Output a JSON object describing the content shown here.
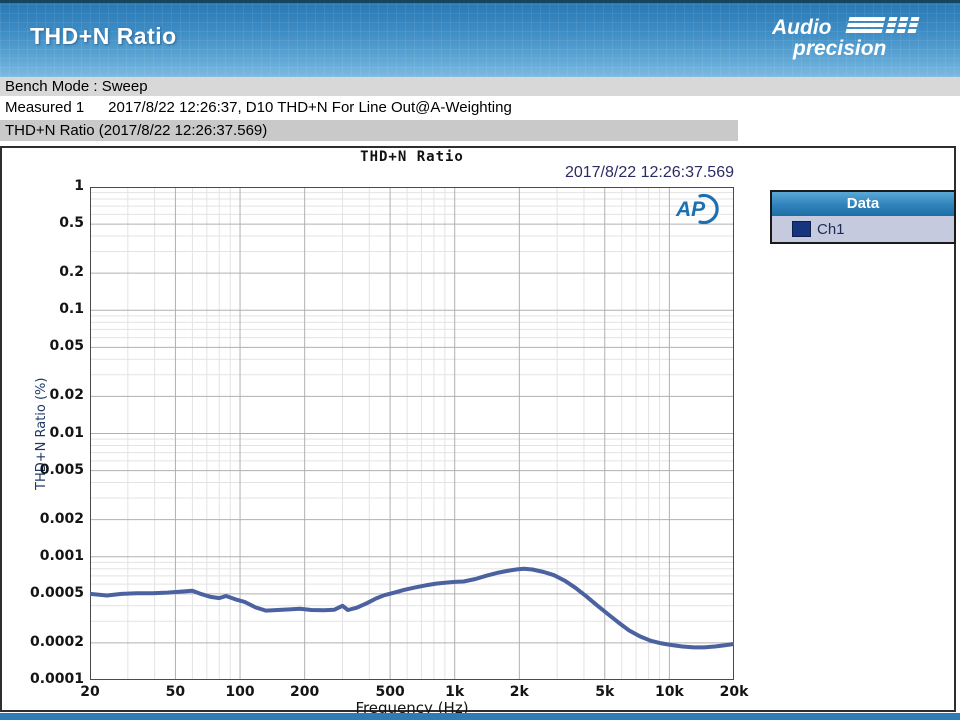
{
  "page": {
    "title": "THD+N Ratio",
    "brand": {
      "line1": "Audio",
      "line2": "precision"
    },
    "bench_mode": "Bench Mode : Sweep",
    "measured_label": "Measured 1",
    "measured_value": "2017/8/22 12:26:37, D10 THD+N For Line Out@A-Weighting",
    "section_title": "THD+N Ratio (2017/8/22 12:26:37.569)"
  },
  "chart": {
    "title": "THD+N Ratio",
    "timestamp": "2017/8/22 12:26:37.569",
    "ap_logo_text": "AP",
    "legend": {
      "header": "Data",
      "items": [
        {
          "label": "Ch1",
          "color": "#16357f"
        }
      ]
    }
  },
  "chart_data": {
    "type": "line",
    "title": "THD+N Ratio",
    "xlabel": "Frequency (Hz)",
    "ylabel": "THD+N Ratio (%)",
    "x_scale": "log",
    "y_scale": "log",
    "xlim": [
      20,
      20000
    ],
    "ylim": [
      0.0001,
      1
    ],
    "grid": "on",
    "legend_position": "outside-right",
    "colors": {
      "curve": "#4c62a0",
      "major_grid": "#b0b0b0",
      "minor_grid": "#e3e3e3",
      "plot_border": "#4a4a4a"
    },
    "x_ticks": [
      {
        "v": 20,
        "l": "20"
      },
      {
        "v": 50,
        "l": "50"
      },
      {
        "v": 100,
        "l": "100"
      },
      {
        "v": 200,
        "l": "200"
      },
      {
        "v": 500,
        "l": "500"
      },
      {
        "v": 1000,
        "l": "1k"
      },
      {
        "v": 2000,
        "l": "2k"
      },
      {
        "v": 5000,
        "l": "5k"
      },
      {
        "v": 10000,
        "l": "10k"
      },
      {
        "v": 20000,
        "l": "20k"
      }
    ],
    "y_ticks": [
      {
        "v": 1,
        "l": "1"
      },
      {
        "v": 0.5,
        "l": "0.5"
      },
      {
        "v": 0.2,
        "l": "0.2"
      },
      {
        "v": 0.1,
        "l": "0.1"
      },
      {
        "v": 0.05,
        "l": "0.05"
      },
      {
        "v": 0.02,
        "l": "0.02"
      },
      {
        "v": 0.01,
        "l": "0.01"
      },
      {
        "v": 0.005,
        "l": "0.005"
      },
      {
        "v": 0.002,
        "l": "0.002"
      },
      {
        "v": 0.001,
        "l": "0.001"
      },
      {
        "v": 0.0005,
        "l": "0.0005"
      },
      {
        "v": 0.0002,
        "l": "0.0002"
      },
      {
        "v": 0.0001,
        "l": "0.0001"
      }
    ],
    "series": [
      {
        "name": "Ch1",
        "points": [
          [
            20,
            0.0005
          ],
          [
            24,
            0.000485
          ],
          [
            28,
            0.0005
          ],
          [
            33,
            0.000505
          ],
          [
            39,
            0.000505
          ],
          [
            46,
            0.000512
          ],
          [
            54,
            0.000522
          ],
          [
            60,
            0.00053
          ],
          [
            66,
            0.000498
          ],
          [
            73,
            0.000472
          ],
          [
            80,
            0.000462
          ],
          [
            86,
            0.00048
          ],
          [
            95,
            0.000452
          ],
          [
            105,
            0.00043
          ],
          [
            118,
            0.000388
          ],
          [
            132,
            0.000366
          ],
          [
            150,
            0.00037
          ],
          [
            170,
            0.000374
          ],
          [
            190,
            0.000378
          ],
          [
            215,
            0.00037
          ],
          [
            245,
            0.000368
          ],
          [
            275,
            0.000372
          ],
          [
            300,
            0.0004
          ],
          [
            318,
            0.00037
          ],
          [
            350,
            0.000386
          ],
          [
            390,
            0.00042
          ],
          [
            430,
            0.000458
          ],
          [
            470,
            0.000488
          ],
          [
            520,
            0.00051
          ],
          [
            580,
            0.000538
          ],
          [
            650,
            0.000562
          ],
          [
            730,
            0.000585
          ],
          [
            820,
            0.000605
          ],
          [
            900,
            0.000615
          ],
          [
            1000,
            0.000625
          ],
          [
            1100,
            0.00063
          ],
          [
            1250,
            0.00066
          ],
          [
            1400,
            0.0007
          ],
          [
            1600,
            0.000744
          ],
          [
            1800,
            0.000774
          ],
          [
            1950,
            0.00079
          ],
          [
            2100,
            0.0008
          ],
          [
            2300,
            0.000788
          ],
          [
            2600,
            0.000752
          ],
          [
            2900,
            0.000708
          ],
          [
            3250,
            0.00064
          ],
          [
            3650,
            0.00056
          ],
          [
            4100,
            0.000478
          ],
          [
            4600,
            0.000404
          ],
          [
            5200,
            0.00034
          ],
          [
            5800,
            0.000292
          ],
          [
            6500,
            0.000252
          ],
          [
            7300,
            0.000226
          ],
          [
            8200,
            0.000208
          ],
          [
            9200,
            0.000198
          ],
          [
            10300,
            0.000192
          ],
          [
            11500,
            0.000187
          ],
          [
            13000,
            0.000184
          ],
          [
            14500,
            0.000184
          ],
          [
            16300,
            0.000187
          ],
          [
            18000,
            0.000191
          ],
          [
            20000,
            0.000196
          ]
        ]
      }
    ]
  }
}
